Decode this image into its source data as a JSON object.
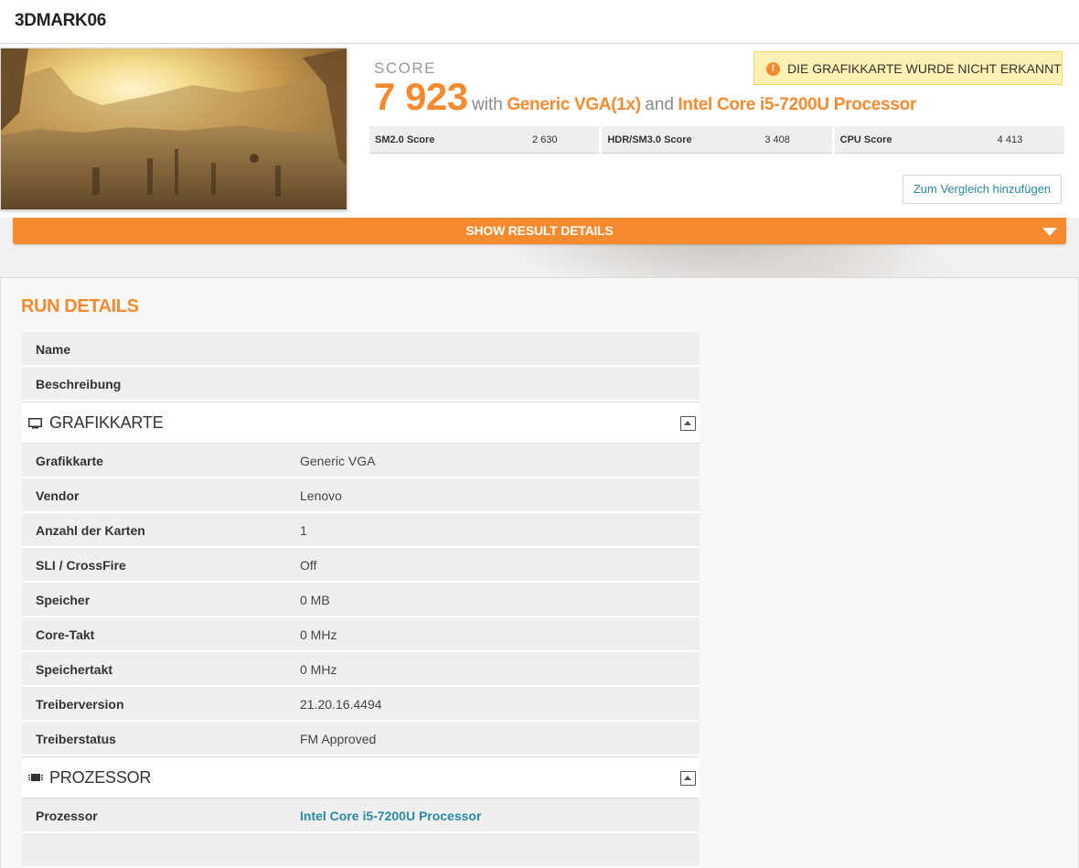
{
  "header": {
    "title": "3DMARK06"
  },
  "result": {
    "score_label": "SCORE",
    "score_value": "7 923",
    "with_text": "with",
    "gpu": "Generic VGA(1x)",
    "and_text": "and",
    "cpu": "Intel Core i5-7200U Processor",
    "warning": "DIE GRAFIKKARTE WURDE NICHT ERKANNT",
    "warning_icon": "exclamation-icon",
    "subscores": [
      {
        "label": "SM2.0 Score",
        "value": "2 630"
      },
      {
        "label": "HDR/SM3.0 Score",
        "value": "3 408"
      },
      {
        "label": "CPU Score",
        "value": "4 413"
      }
    ],
    "compare_button": "Zum Vergleich hinzufügen",
    "details_bar": "SHOW RESULT DETAILS"
  },
  "run_details": {
    "title": "RUN DETAILS",
    "general": [
      {
        "label": "Name",
        "value": ""
      },
      {
        "label": "Beschreibung",
        "value": ""
      }
    ],
    "gpu_section": {
      "title": "GRAFIKKARTE",
      "icon": "monitor-icon",
      "rows": [
        {
          "label": "Grafikkarte",
          "value": "Generic VGA"
        },
        {
          "label": "Vendor",
          "value": "Lenovo"
        },
        {
          "label": "Anzahl der Karten",
          "value": "1"
        },
        {
          "label": "SLI / CrossFire",
          "value": "Off"
        },
        {
          "label": "Speicher",
          "value": "0 MB"
        },
        {
          "label": "Core-Takt",
          "value": "0 MHz"
        },
        {
          "label": "Speichertakt",
          "value": "0 MHz"
        },
        {
          "label": "Treiberversion",
          "value": "21.20.16.4494"
        },
        {
          "label": "Treiberstatus",
          "value": "FM Approved"
        }
      ]
    },
    "cpu_section": {
      "title": "PROZESSOR",
      "icon": "cpu-chip-icon",
      "rows": [
        {
          "label": "Prozessor",
          "value": "Intel Core i5-7200U Processor"
        }
      ]
    }
  },
  "colors": {
    "accent": "#f68a2e",
    "link": "#2a8aa8",
    "warning_bg": "#fcf1b3"
  }
}
